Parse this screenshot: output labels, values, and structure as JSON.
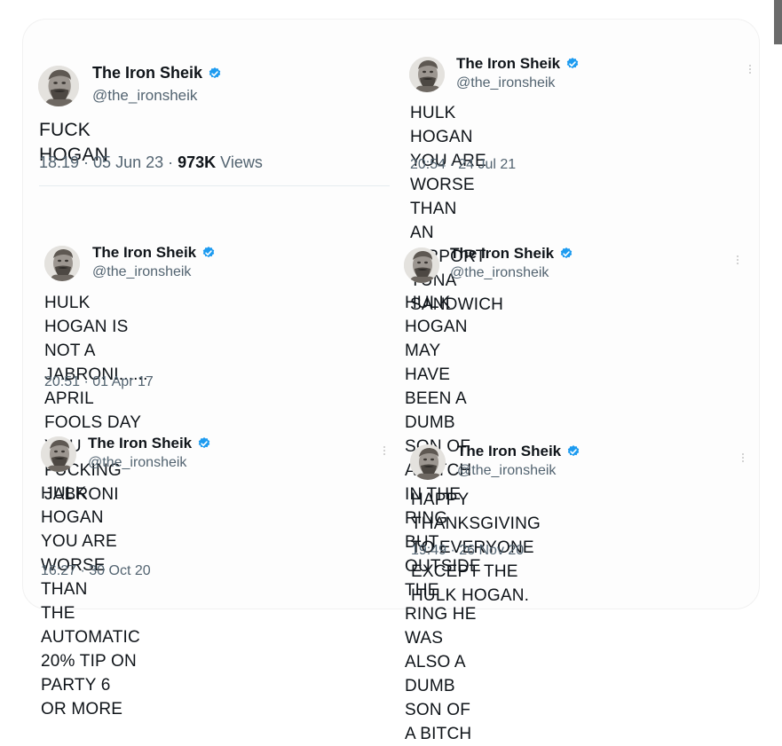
{
  "accent": "#1d9bf0",
  "tweets": [
    {
      "name": "The Iron Sheik",
      "handle": "@the_ironsheik",
      "text": "FUCK HOGAN",
      "time": "18:19",
      "date": "05 Jun 23",
      "views_count": "973K",
      "views_label": "Views"
    },
    {
      "name": "The Iron Sheik",
      "handle": "@the_ironsheik",
      "text": "HULK HOGAN YOU ARE WORSE THAN\nAN AIRPORT TUNA SANDWICH",
      "timestamp": "20:54 · 24 Jul 21"
    },
    {
      "name": "The Iron Sheik",
      "handle": "@the_ironsheik",
      "text": "HULK HOGAN IS NOT A JABRONI......\nAPRIL FOOLS DAY YOU FUCKING\nJABRONI",
      "timestamp": "20:51 · 01 Apr 17"
    },
    {
      "name": "The Iron Sheik",
      "handle": "@the_ironsheik",
      "text": "HULK HOGAN MAY HAVE BEEN A DUMB\nSON OF A BITCH IN THE RING BUT\nOUTSIDE THE RING HE WAS ALSO A\nDUMB SON OF A BITCH",
      "timestamp": ""
    },
    {
      "name": "The Iron Sheik",
      "handle": "@the_ironsheik",
      "text": "HULK HOGAN YOU ARE WORSE THAN\nTHE AUTOMATIC 20% TIP ON PARTY 6\nOR MORE",
      "timestamp": "16:27 · 30 Oct 20"
    },
    {
      "name": "The Iron Sheik",
      "handle": "@the_ironsheik",
      "text": "HAPPY THANKSGIVING TO EVERYONE\nEXCEPT THE HULK HOGAN.",
      "timestamp": "19:49 · 26 Nov 20"
    }
  ],
  "icons": {
    "verified": "verified-badge-icon",
    "more": "more-options-icon",
    "avatar": "avatar"
  }
}
